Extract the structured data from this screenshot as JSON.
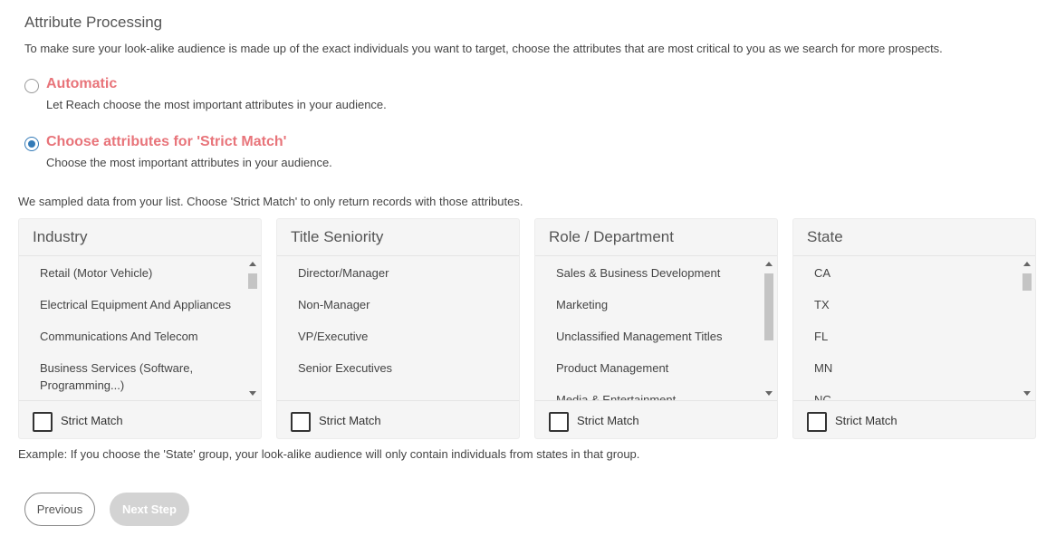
{
  "header": {
    "title": "Attribute Processing",
    "intro": "To make sure your look-alike audience is made up of the exact individuals you want to target, choose the attributes that are most critical to you as we search for more prospects."
  },
  "options": {
    "automatic": {
      "label": "Automatic",
      "description": "Let Reach choose the most important attributes in your audience.",
      "selected": false
    },
    "strict": {
      "label": "Choose attributes for 'Strict Match'",
      "description": "Choose the most important attributes in your audience.",
      "selected": true
    }
  },
  "sampled_text": "We sampled data from your list. Choose 'Strict Match' to only return records with those attributes.",
  "cards": [
    {
      "title": "Industry",
      "items": [
        "Retail (Motor Vehicle)",
        "Electrical Equipment And Appliances",
        "Communications And Telecom",
        "Business Services (Software, Programming...)"
      ],
      "checkbox_label": "Strict Match"
    },
    {
      "title": "Title Seniority",
      "items": [
        "Director/Manager",
        "Non-Manager",
        "VP/Executive",
        "Senior Executives"
      ],
      "checkbox_label": "Strict Match"
    },
    {
      "title": "Role / Department",
      "items": [
        "Sales & Business Development",
        "Marketing",
        "Unclassified Management Titles",
        "Product Management",
        "Media & Entertainment"
      ],
      "checkbox_label": "Strict Match"
    },
    {
      "title": "State",
      "items": [
        "CA",
        "TX",
        "FL",
        "MN",
        "NC"
      ],
      "checkbox_label": "Strict Match"
    }
  ],
  "example_text": "Example: If you choose the 'State' group, your look-alike audience will only contain individuals from states in that group.",
  "buttons": {
    "previous": "Previous",
    "next": "Next Step"
  },
  "colors": {
    "accent": "#e8747a",
    "radio": "#337ab7",
    "disabled": "#d3d3d3"
  }
}
